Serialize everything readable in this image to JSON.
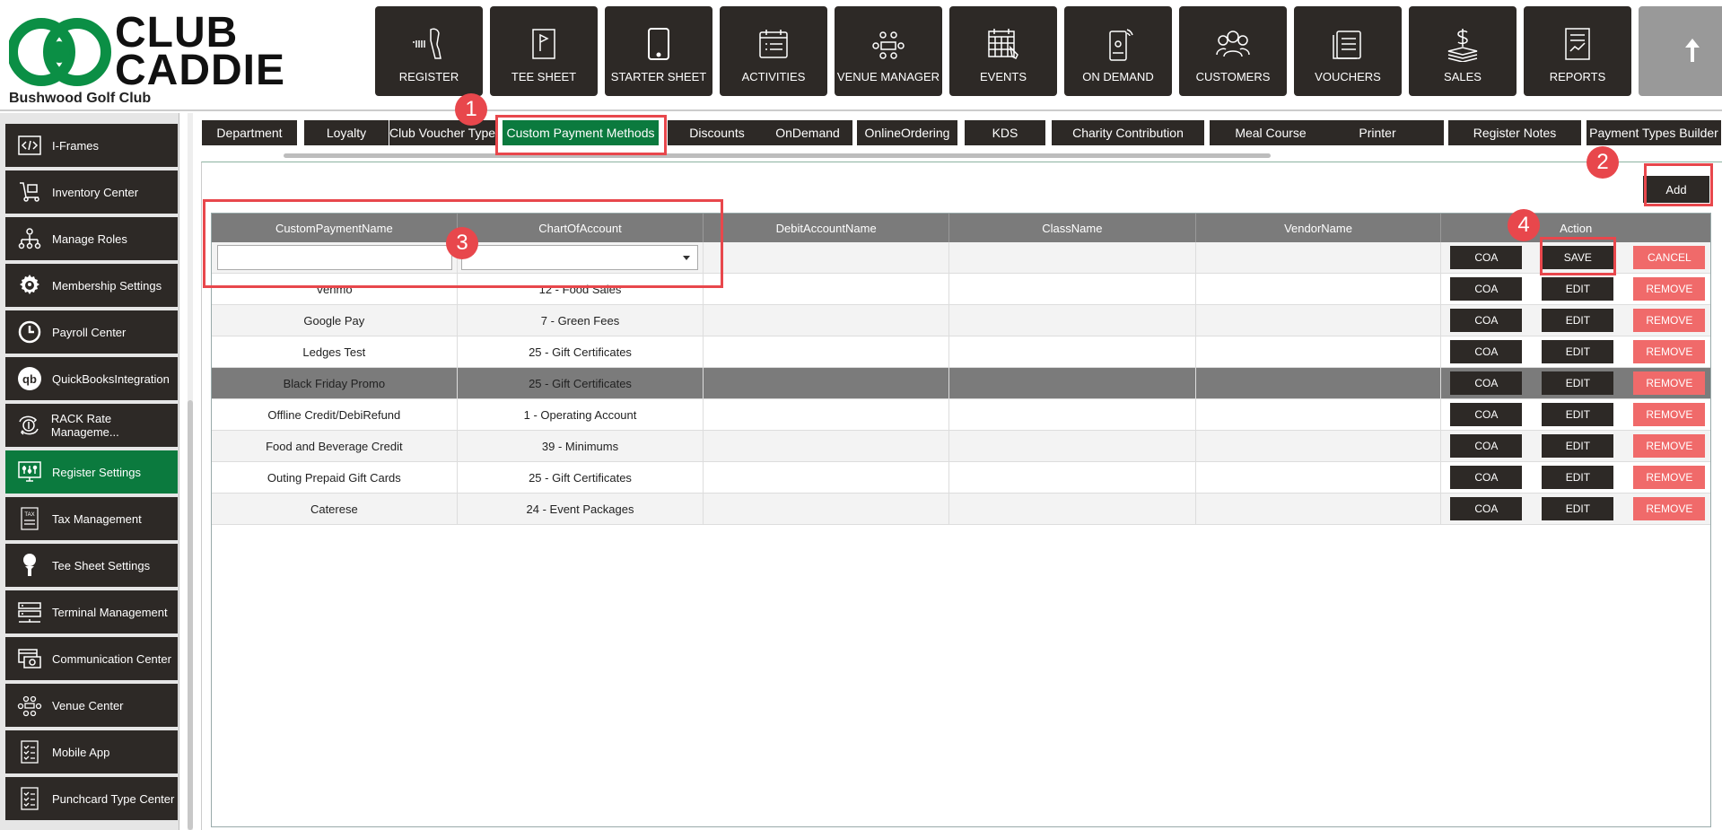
{
  "brand": {
    "logo_line1": "CLUB",
    "logo_line2": "CADDIE",
    "club_name": "Bushwood Golf Club",
    "logo_color": "#0b8f45"
  },
  "topnav": [
    {
      "label": "REGISTER",
      "icon": "barcode-scanner-icon"
    },
    {
      "label": "TEE SHEET",
      "icon": "tee-sheet-icon"
    },
    {
      "label": "STARTER SHEET",
      "icon": "tablet-icon"
    },
    {
      "label": "ACTIVITIES",
      "icon": "activities-icon"
    },
    {
      "label": "VENUE MANAGER",
      "icon": "venue-icon"
    },
    {
      "label": "EVENTS",
      "icon": "calendar-icon"
    },
    {
      "label": "ON DEMAND",
      "icon": "mobile-icon"
    },
    {
      "label": "CUSTOMERS",
      "icon": "customers-icon"
    },
    {
      "label": "VOUCHERS",
      "icon": "vouchers-icon"
    },
    {
      "label": "SALES",
      "icon": "sales-icon"
    },
    {
      "label": "REPORTS",
      "icon": "reports-icon"
    },
    {
      "label": "",
      "icon": "arrow-up-icon"
    }
  ],
  "sidebar": {
    "items": [
      {
        "label": "I-Frames",
        "icon": "code-icon"
      },
      {
        "label": "Inventory Center",
        "icon": "inventory-icon"
      },
      {
        "label": "Manage Roles",
        "icon": "roles-icon"
      },
      {
        "label": "Membership Settings",
        "icon": "gear-icon"
      },
      {
        "label": "Payroll Center",
        "icon": "clock-icon"
      },
      {
        "label": "QuickBooksIntegration",
        "icon": "quickbooks-icon"
      },
      {
        "label": "RACK Rate Manageme...",
        "icon": "rack-rate-icon"
      },
      {
        "label": "Register Settings",
        "icon": "register-settings-icon",
        "active": true
      },
      {
        "label": "Tax Management",
        "icon": "tax-icon"
      },
      {
        "label": "Tee Sheet Settings",
        "icon": "golf-tee-icon"
      },
      {
        "label": "Terminal Management",
        "icon": "terminal-icon"
      },
      {
        "label": "Communication Center",
        "icon": "communication-icon"
      },
      {
        "label": "Venue Center",
        "icon": "venue-center-icon"
      },
      {
        "label": "Mobile App",
        "icon": "mobile-app-icon"
      },
      {
        "label": "Punchcard Type Center",
        "icon": "punchcard-icon"
      }
    ]
  },
  "tabs": [
    {
      "label": "Department"
    },
    {
      "label": "Loyalty"
    },
    {
      "label": "Club Voucher Type"
    },
    {
      "label": "Custom Payment Methods",
      "active": true
    },
    {
      "label": "Discounts"
    },
    {
      "label": "OnDemand"
    },
    {
      "label": "OnlineOrdering"
    },
    {
      "label": "KDS"
    },
    {
      "label": "Charity Contribution"
    },
    {
      "label": "Meal Course"
    },
    {
      "label": "Printer"
    },
    {
      "label": "Register Notes"
    },
    {
      "label": "Payment Types Builder"
    }
  ],
  "toolbar": {
    "add_label": "Add"
  },
  "grid": {
    "columns": [
      "CustomPaymentName",
      "ChartOfAccount",
      "DebitAccountName",
      "ClassName",
      "VendorName",
      "Action"
    ],
    "new_row": {
      "name_value": "",
      "account_value": "",
      "coa_label": "COA",
      "save_label": "SAVE",
      "cancel_label": "CANCEL"
    },
    "rows": [
      {
        "name": "Venmo",
        "account": "12 - Food Sales"
      },
      {
        "name": "Google Pay",
        "account": "7 - Green Fees"
      },
      {
        "name": "Ledges Test",
        "account": "25 - Gift Certificates"
      },
      {
        "name": "Black Friday Promo",
        "account": "25 - Gift Certificates",
        "selected": true
      },
      {
        "name": "Offline Credit/DebiRefund",
        "account": "1 - Operating Account"
      },
      {
        "name": "Food and Beverage Credit",
        "account": "39 - Minimums"
      },
      {
        "name": "Outing Prepaid Gift Cards",
        "account": "25 - Gift Certificates"
      },
      {
        "name": "Caterese",
        "account": "24 - Event Packages"
      }
    ],
    "coa_label": "COA",
    "edit_label": "EDIT",
    "remove_label": "REMOVE"
  },
  "annotations": [
    "1",
    "2",
    "3",
    "4"
  ],
  "colors": {
    "accent_green": "#0b7a3e",
    "dark": "#2d2926",
    "remove_red": "#f06a6a",
    "annotation_red": "#e8474c"
  }
}
